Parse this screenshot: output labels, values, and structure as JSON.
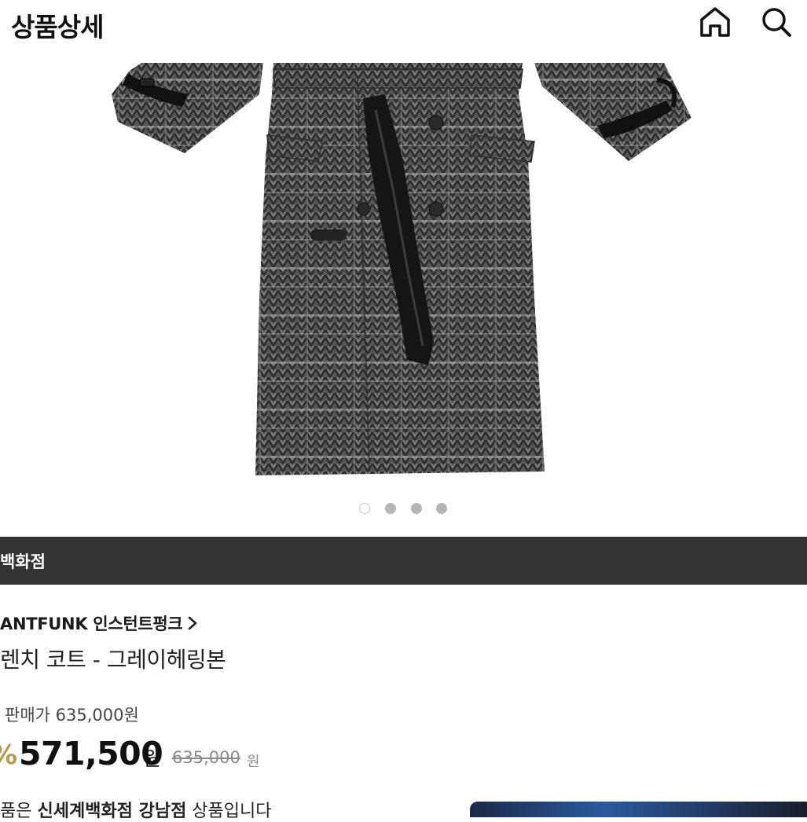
{
  "header": {
    "title": "상품상세",
    "icons": [
      "home-icon",
      "search-icon"
    ]
  },
  "product_image": {
    "description_icon": "coat-image",
    "carousel": {
      "count": 4,
      "active_index": 0
    }
  },
  "store": {
    "name": "백화점"
  },
  "product": {
    "brand": "ANTFUNK 인스턴트펑크",
    "name": "렌치 코트 - 그레이헤링본",
    "list_price_label": "판매가 635,000원",
    "discount_symbol": "%",
    "sale_price": "571,500",
    "sale_price_unit": "원",
    "original_price": "635,000",
    "original_price_unit": "원"
  },
  "notice": {
    "prefix": "품은 ",
    "bold": "신세계백화점 강남점",
    "suffix": " 상품입니다"
  },
  "colors": {
    "store_bar": "#333333",
    "discount": "#b89a4e",
    "strike": "#8a8a8a"
  }
}
